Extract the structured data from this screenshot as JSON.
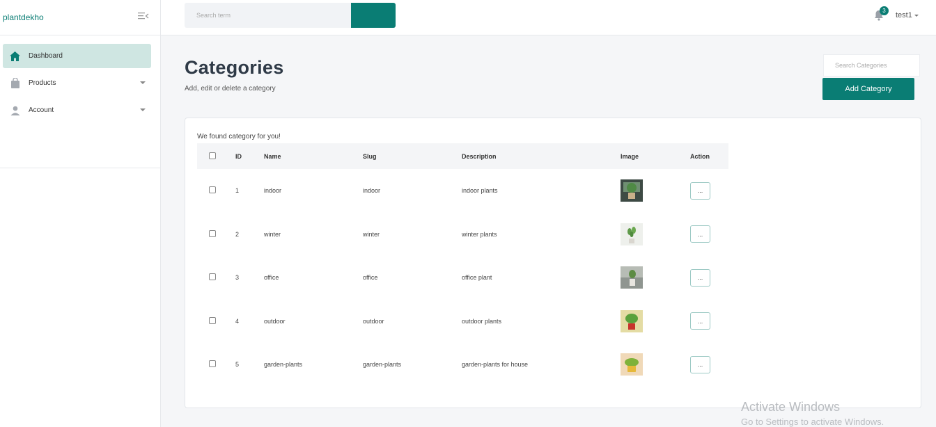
{
  "brand": "plantdekho",
  "sidebar": {
    "items": [
      {
        "label": "Dashboard",
        "icon": "home-icon",
        "active": true
      },
      {
        "label": "Products",
        "icon": "bag-icon"
      },
      {
        "label": "Account",
        "icon": "user-icon"
      }
    ]
  },
  "topbar": {
    "search_placeholder": "Search term",
    "notification_count": "3",
    "username": "test1"
  },
  "page": {
    "title": "Categories",
    "subtitle": "Add, edit or delete a category",
    "search_placeholder": "Search Categories",
    "add_button": "Add Category"
  },
  "table": {
    "message": "We found category for you!",
    "headers": [
      "ID",
      "Name",
      "Slug",
      "Description",
      "Image",
      "Action"
    ],
    "rows": [
      {
        "id": "1",
        "name": "indoor",
        "slug": "indoor",
        "description": "indoor plants",
        "action": "..."
      },
      {
        "id": "2",
        "name": "winter",
        "slug": "winter",
        "description": "winter plants",
        "action": "..."
      },
      {
        "id": "3",
        "name": "office",
        "slug": "office",
        "description": "office plant",
        "action": "..."
      },
      {
        "id": "4",
        "name": "outdoor",
        "slug": "outdoor",
        "description": "outdoor plants",
        "action": "..."
      },
      {
        "id": "5",
        "name": "garden-plants",
        "slug": "garden-plants",
        "description": "garden-plants for house",
        "action": "..."
      }
    ]
  },
  "watermark": {
    "line1": "Activate Windows",
    "line2": "Go to Settings to activate Windows."
  },
  "colors": {
    "accent": "#0a7d74",
    "active_nav": "#cfe6e2"
  }
}
